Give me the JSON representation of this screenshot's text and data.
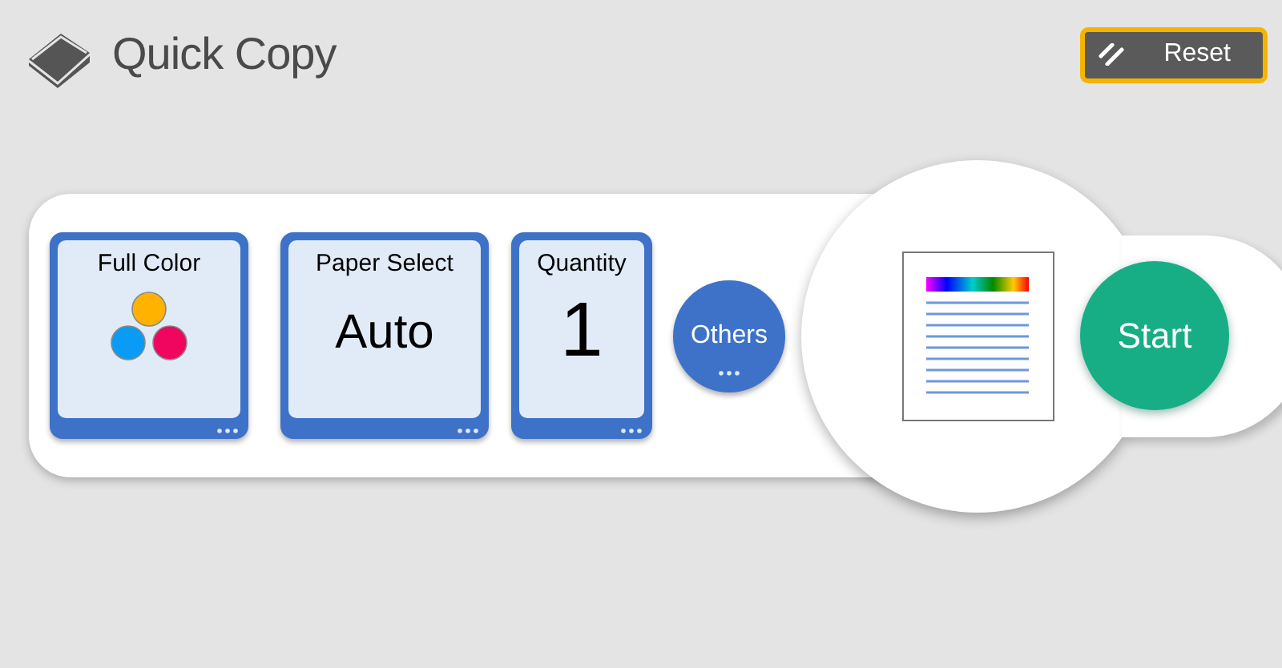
{
  "header": {
    "title": "Quick Copy"
  },
  "reset_button": {
    "label": "Reset"
  },
  "settings": [
    {
      "kind": "color",
      "label": "Full Color"
    },
    {
      "kind": "text",
      "label": "Paper Select",
      "value": "Auto"
    },
    {
      "kind": "number",
      "label": "Quantity",
      "value": "1"
    }
  ],
  "others_button": {
    "label": "Others"
  },
  "start_button": {
    "label": "Start"
  }
}
